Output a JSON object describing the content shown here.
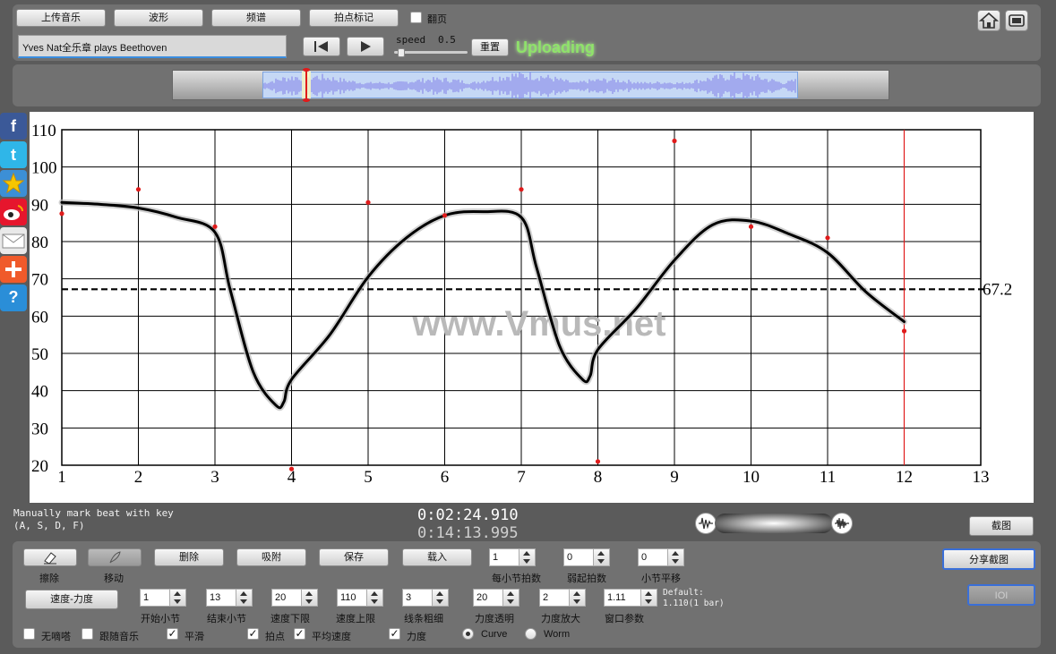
{
  "toolbar": {
    "upload_music": "上传音乐",
    "waveform": "波形",
    "spectrum": "频谱",
    "beat_mark": "拍点标记",
    "page_flip": "翻页",
    "title_input_value": "Yves Nat全乐章 plays Beethoven",
    "speed_label": "speed",
    "speed_value": "0.5",
    "speed_fraction": 0.05,
    "reset": "重置",
    "status": "Uploading"
  },
  "overview": {
    "playhead_fraction": 0.08
  },
  "chart_data": {
    "type": "line",
    "x": [
      1,
      1.5,
      2,
      2.5,
      3,
      3.2,
      3.5,
      3.8,
      3.9,
      4,
      4.5,
      5,
      5.5,
      6,
      6.5,
      7,
      7.2,
      7.5,
      7.8,
      7.9,
      8,
      8.5,
      9,
      9.5,
      10,
      10.5,
      11,
      11.5,
      12
    ],
    "y": [
      90.5,
      90,
      89,
      86.5,
      82.5,
      67,
      45,
      36,
      37,
      43,
      55,
      70.5,
      81,
      87,
      88,
      86.5,
      73,
      52,
      43,
      44,
      51,
      62,
      75,
      84.5,
      85.5,
      82,
      77,
      66.5,
      58.5
    ],
    "beats_x": [
      1,
      2,
      3,
      4,
      5,
      6,
      7,
      8,
      9,
      10,
      11,
      12
    ],
    "beats_y": [
      87.5,
      94,
      84,
      19,
      90.5,
      87,
      94,
      21,
      107,
      84,
      81,
      56
    ],
    "average": 67.2,
    "average_label": "67.2",
    "xlim": [
      1,
      13
    ],
    "ylim": [
      20,
      110
    ],
    "x_ticks": [
      "1",
      "2",
      "3",
      "4",
      "5",
      "6",
      "7",
      "8",
      "9",
      "10",
      "11",
      "12",
      "13"
    ],
    "y_ticks": [
      "20",
      "30",
      "40",
      "50",
      "60",
      "70",
      "80",
      "90",
      "100",
      "110"
    ],
    "cursor_x": 12,
    "watermark": "www.Vmus.net",
    "grid": true
  },
  "status_bar": {
    "hint_line1": "Manually mark beat with key",
    "hint_line2": "(A, S, D, F)",
    "time_current": "0:02:24.910",
    "time_total": "0:14:13.995",
    "screenshot": "截图"
  },
  "controls": {
    "erase": "擦除",
    "move": "移动",
    "delete": "删除",
    "snap": "吸附",
    "save": "保存",
    "load": "载入",
    "beats_per_bar_label": "每小节拍数",
    "beats_per_bar": "1",
    "pickup_label": "弱起拍数",
    "pickup": "0",
    "shift_label": "小节平移",
    "shift": "0",
    "share": "分享截图",
    "ioi": "IOI",
    "mode": "速度-力度",
    "start_bar_label": "开始小节",
    "start_bar": "1",
    "end_bar_label": "结束小节",
    "end_bar": "13",
    "speed_min_label": "速度下限",
    "speed_min": "20",
    "speed_max_label": "速度上限",
    "speed_max": "110",
    "line_width_label": "线条粗细",
    "line_width": "3",
    "dyn_alpha_label": "力度透明",
    "dyn_alpha": "20",
    "dyn_zoom_label": "力度放大",
    "dyn_zoom": "2",
    "window_label": "窗口参数",
    "window": "1.11",
    "default_line1": "Default:",
    "default_line2": "1.110(1 bar)",
    "no_click": "无嘀嗒",
    "follow_music": "跟随音乐",
    "smooth": "平滑",
    "beat_points": "拍点",
    "avg_speed": "平均速度",
    "dynamics": "力度",
    "curve": "Curve",
    "worm": "Worm"
  },
  "colors": {
    "status_green": "#8fe36a",
    "waveform": "#8b8bea",
    "playhead": "#e01b1b",
    "beat_point": "#e01b1b"
  }
}
